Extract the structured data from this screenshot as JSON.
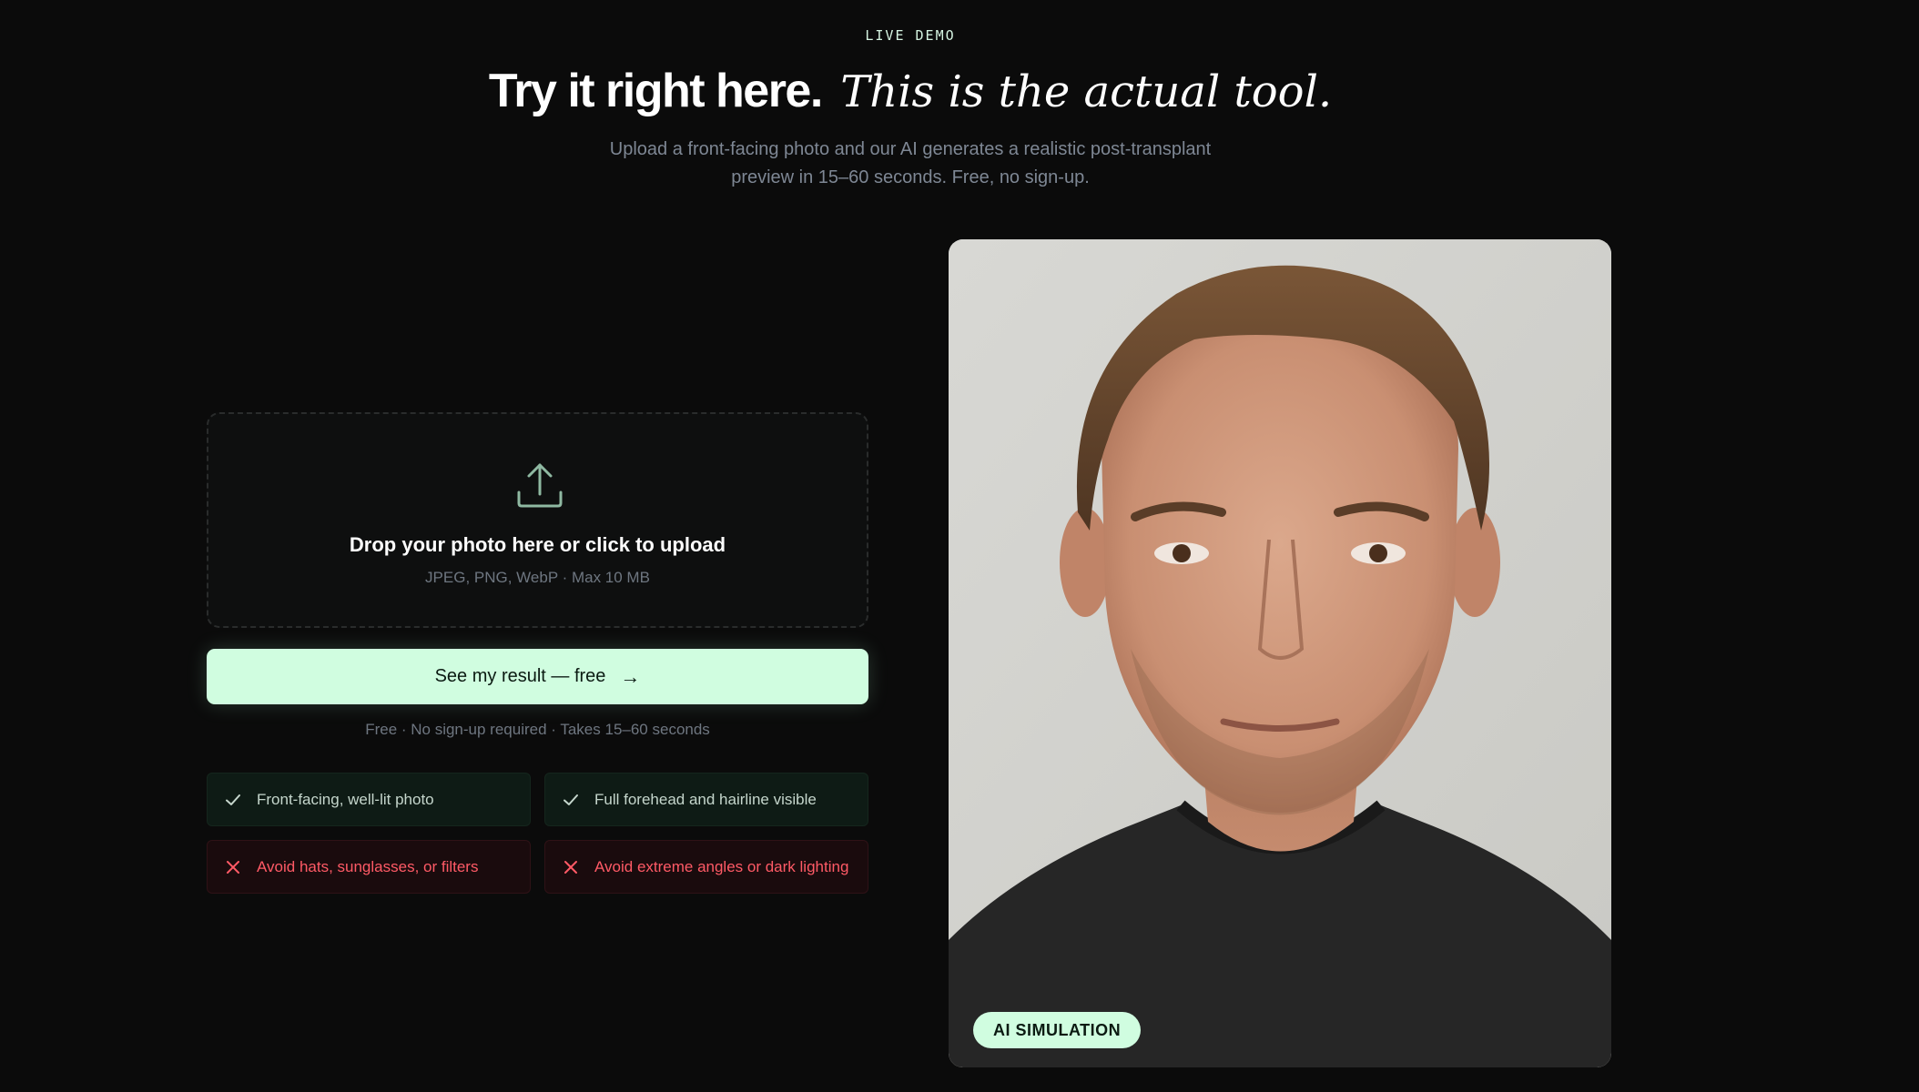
{
  "section": {
    "eyebrow": "LIVE DEMO",
    "heading_bold": "Try it right here.",
    "heading_italic": "This is the actual tool.",
    "subtitle_line1": "Upload a front-facing photo and our AI generates a realistic post-transplant",
    "subtitle_line2": "preview in 15–60 seconds. Free, no sign-up."
  },
  "upload": {
    "icon": "upload-icon",
    "title": "Drop your photo here or click to upload",
    "hint": "JPEG, PNG, WebP · Max 10 MB"
  },
  "cta": {
    "label": "See my result — free",
    "arrow": "→",
    "note": "Free · No sign-up required · Takes 15–60 seconds"
  },
  "tips": [
    {
      "type": "good",
      "icon": "check-icon",
      "text": "Front-facing, well-lit photo"
    },
    {
      "type": "good",
      "icon": "check-icon",
      "text": "Full forehead and hairline visible"
    },
    {
      "type": "bad",
      "icon": "x-icon",
      "text": "Avoid hats, sunglasses, or filters"
    },
    {
      "type": "bad",
      "icon": "x-icon",
      "text": "Avoid extreme angles or dark lighting"
    }
  ],
  "preview": {
    "badge": "AI SIMULATION"
  },
  "colors": {
    "background": "#0b0b0b",
    "accent": "#d0fde0",
    "good_text": "#c5d6cc",
    "bad_text": "#ff5a66"
  }
}
